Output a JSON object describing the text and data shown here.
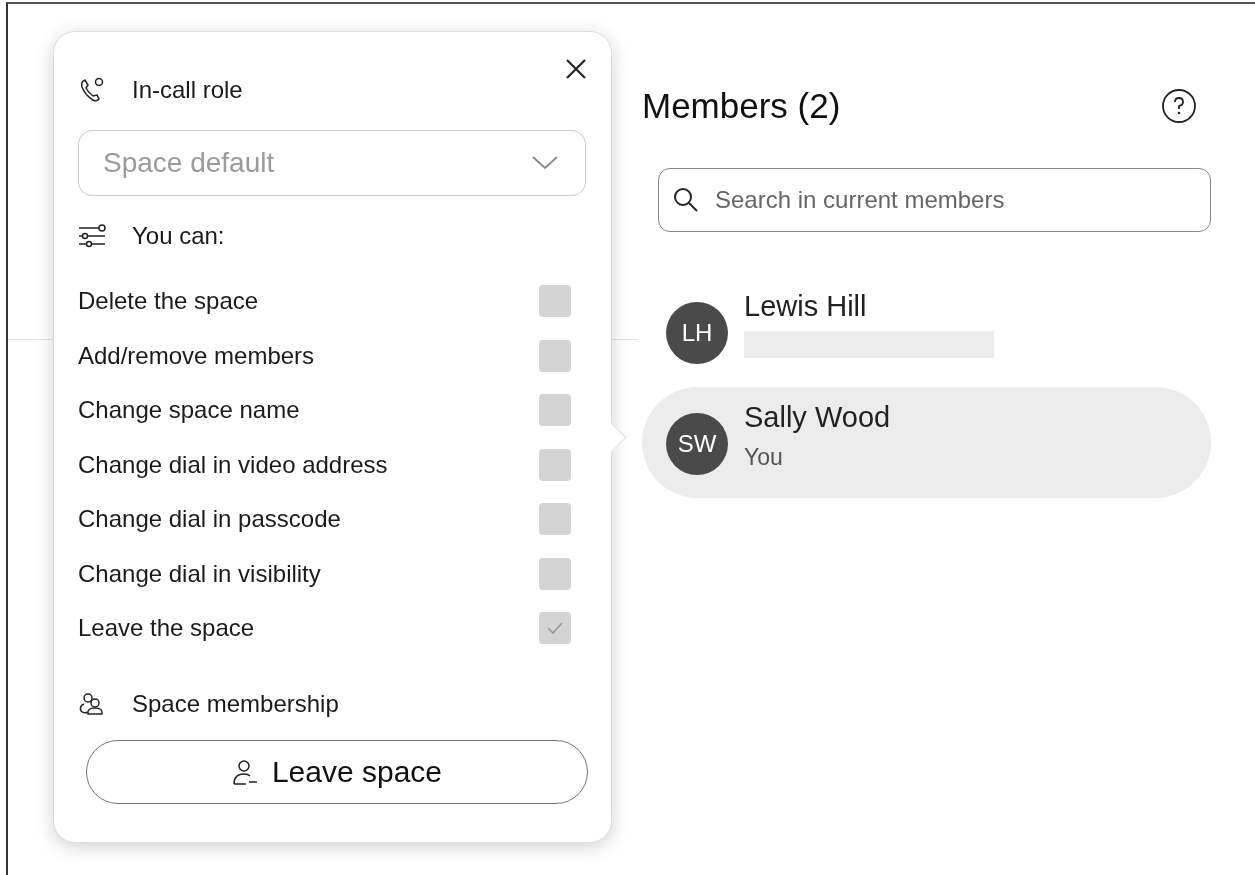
{
  "role_panel": {
    "title": "In-call role",
    "role_select": {
      "placeholder": "Space default"
    },
    "permissions_title": "You can:",
    "permissions": [
      {
        "label": "Delete the space",
        "checked": false,
        "disabled": true
      },
      {
        "label": "Add/remove members",
        "checked": false,
        "disabled": true
      },
      {
        "label": "Change space name",
        "checked": false,
        "disabled": true
      },
      {
        "label": "Change dial in video address",
        "checked": false,
        "disabled": true
      },
      {
        "label": "Change dial in passcode",
        "checked": false,
        "disabled": true
      },
      {
        "label": "Change dial in visibility",
        "checked": false,
        "disabled": true
      },
      {
        "label": "Leave the space",
        "checked": true,
        "disabled": true
      }
    ],
    "membership_title": "Space membership",
    "leave_button": "Leave space"
  },
  "members": {
    "title": "Members (2)",
    "search": {
      "placeholder": "Search in current members"
    },
    "list": [
      {
        "initials": "LH",
        "name": "Lewis Hill",
        "detail_redacted": true,
        "selected": false
      },
      {
        "initials": "SW",
        "name": "Sally Wood",
        "subtitle": "You",
        "selected": true
      }
    ]
  }
}
